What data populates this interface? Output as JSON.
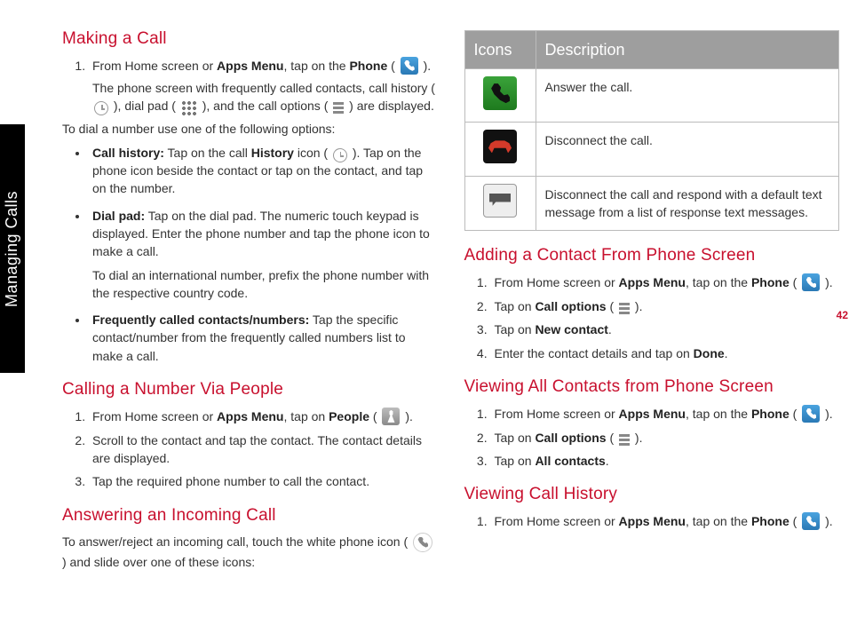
{
  "pageNumber": "42",
  "sideTab": "Managing Calls",
  "left": {
    "h1": "Making a Call",
    "s1_li1_a": "From Home screen or ",
    "s1_li1_b": "Apps Menu",
    "s1_li1_c": ", tap on the ",
    "s1_li1_d": "Phone",
    "s1_li1_e": " ( ",
    "s1_li1_f": " ).",
    "s1_li1_desc_a": "The phone screen with frequently called contacts, call history ( ",
    "s1_li1_desc_b": " ), dial pad ( ",
    "s1_li1_desc_c": " ), and the call options ( ",
    "s1_li1_desc_d": " ) are displayed.",
    "s1_p2": "To dial a number use one of the following options:",
    "bullet1_a": "Call history:",
    "bullet1_b": " Tap on the call ",
    "bullet1_c": "History",
    "bullet1_d": " icon ( ",
    "bullet1_e": " ). Tap on the phone icon beside the contact or tap on the contact, and tap on the number.",
    "bullet2_a": "Dial pad:",
    "bullet2_b": " Tap on the dial pad. The numeric touch keypad is displayed. Enter the phone number and tap the phone icon to make a call.",
    "bullet2_c": "To dial an international number, prefix the phone number with the respective country code.",
    "bullet3_a": "Frequently called contacts/numbers:",
    "bullet3_b": " Tap the specific contact/number from the frequently called numbers list to make a call.",
    "h2": "Calling a Number Via People",
    "s2_li1_a": "From Home screen or ",
    "s2_li1_b": "Apps Menu",
    "s2_li1_c": ", tap on ",
    "s2_li1_d": "People",
    "s2_li1_e": " ( ",
    "s2_li1_f": " ).",
    "s2_li2": "Scroll to the contact and tap the contact. The contact details are displayed.",
    "s2_li3": "Tap the required phone number to call the contact.",
    "h3": "Answering an Incoming Call",
    "s3_p_a": "To answer/reject an incoming call, touch the white phone icon  ( ",
    "s3_p_b": " ) and slide over one of these icons:"
  },
  "right": {
    "th1": "Icons",
    "th2": "Description",
    "row1": "Answer the call.",
    "row2": "Disconnect the call.",
    "row3": "Disconnect the call and respond with a default text message from a list of response text messages.",
    "h1": "Adding a Contact From Phone Screen",
    "r1_li1_a": "From Home screen or ",
    "r1_li1_b": "Apps Menu",
    "r1_li1_c": ", tap on the ",
    "r1_li1_d": "Phone",
    "r1_li1_e": " ( ",
    "r1_li1_f": " ).",
    "r1_li2_a": "Tap on ",
    "r1_li2_b": "Call options",
    "r1_li2_c": " ( ",
    "r1_li2_d": " ).",
    "r1_li3_a": "Tap on ",
    "r1_li3_b": "New contact",
    "r1_li3_c": ".",
    "r1_li4_a": "Enter the contact details and tap on ",
    "r1_li4_b": "Done",
    "r1_li4_c": ".",
    "h2": "Viewing All Contacts from Phone Screen",
    "r2_li1_a": "From Home screen or ",
    "r2_li1_b": "Apps Menu",
    "r2_li1_c": ", tap on the ",
    "r2_li1_d": "Phone",
    "r2_li1_e": " ( ",
    "r2_li1_f": " ).",
    "r2_li2_a": "Tap on ",
    "r2_li2_b": "Call options",
    "r2_li2_c": " ( ",
    "r2_li2_d": " ).",
    "r2_li3_a": "Tap on ",
    "r2_li3_b": "All contacts",
    "r2_li3_c": ".",
    "h3": "Viewing Call History",
    "r3_li1_a": "From Home screen or ",
    "r3_li1_b": "Apps Menu",
    "r3_li1_c": ", tap on the ",
    "r3_li1_d": "Phone",
    "r3_li1_e": " ( ",
    "r3_li1_f": " )."
  }
}
